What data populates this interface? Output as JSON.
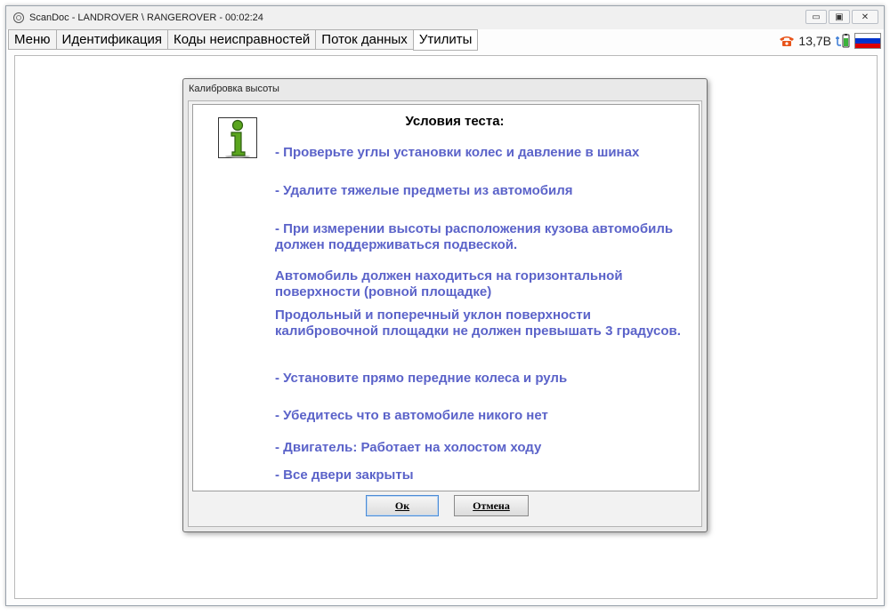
{
  "window": {
    "title": "ScanDoc - LANDROVER \\ RANGEROVER - 00:02:24",
    "controls": {
      "minimize": "▭",
      "restore": "▣",
      "close": "✕"
    }
  },
  "tabs": [
    {
      "label": "Меню",
      "active": false
    },
    {
      "label": "Идентификация",
      "active": false
    },
    {
      "label": "Коды неисправностей",
      "active": false
    },
    {
      "label": "Поток данных",
      "active": false
    },
    {
      "label": "Утилиты",
      "active": true
    }
  ],
  "status": {
    "voltage": "13,7В",
    "phone_icon": "phone-icon",
    "battery_icon": "battery-charging-icon",
    "flag_colors": [
      "#ffffff",
      "#0033cc",
      "#dd0000"
    ]
  },
  "dialog": {
    "title": "Калибровка высоты",
    "heading": "Условия теста:",
    "conditions": [
      "- Проверьте углы установки колес и давление в шинах",
      "- Удалите тяжелые предметы из автомобиля",
      "- При измерении высоты расположения кузова автомобиль должен поддерживаться подвеской.",
      "Автомобиль должен находиться на горизонтальной поверхности (ровной площадке)",
      "Продольный и поперечный уклон поверхности калибровочной площадки не должен превышать 3 градусов.",
      "- Установите прямо передние колеса и руль",
      "- Убедитесь что в автомобиле никого нет",
      "- Двигатель: Работает на холостом ходу",
      "- Все двери закрыты"
    ],
    "ok_label": "Ок",
    "cancel_label": "Отмена"
  },
  "colors": {
    "condition_text": "#5b63c9",
    "accent_phone": "#e8541a",
    "info_icon_green": "#5aa51e"
  }
}
